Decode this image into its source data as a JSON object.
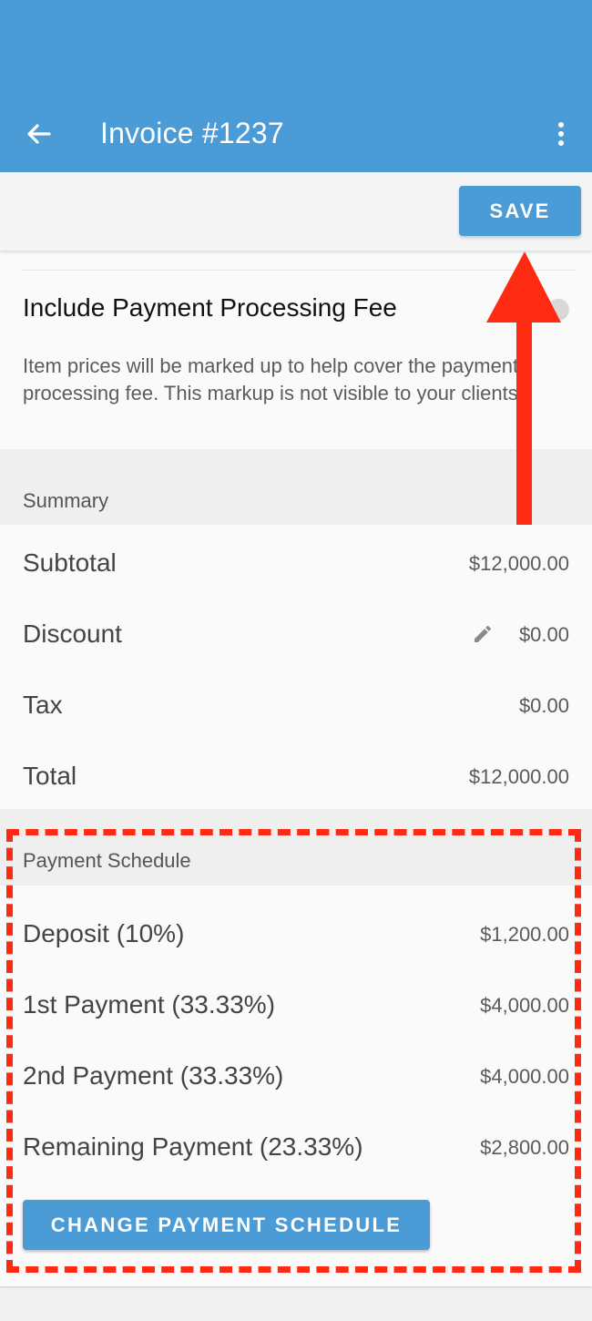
{
  "app_bar": {
    "title": "Invoice #1237",
    "back_icon": "arrow-left-icon",
    "menu_icon": "more-vert-icon",
    "color": "#4a9bd6"
  },
  "toolbar": {
    "save_label": "SAVE"
  },
  "payment_fee": {
    "title": "Include Payment Processing Fee",
    "description": "Item prices will be marked up to help cover the payment processing fee. This markup is not visible to your clients.",
    "enabled": false
  },
  "summary": {
    "header": "Summary",
    "rows": [
      {
        "label": "Subtotal",
        "value": "$12,000.00"
      },
      {
        "label": "Discount",
        "value": "$0.00",
        "icon": "pencil-icon"
      },
      {
        "label": "Tax",
        "value": "$0.00"
      },
      {
        "label": "Total",
        "value": "$12,000.00"
      }
    ]
  },
  "payment_schedule": {
    "header": "Payment Schedule",
    "rows": [
      {
        "label": "Deposit (10%)",
        "value": "$1,200.00"
      },
      {
        "label": "1st Payment (33.33%)",
        "value": "$4,000.00"
      },
      {
        "label": "2nd Payment (33.33%)",
        "value": "$4,000.00"
      },
      {
        "label": "Remaining Payment (23.33%)",
        "value": "$2,800.00"
      }
    ],
    "button_label": "CHANGE PAYMENT SCHEDULE"
  },
  "annotations": {
    "color": "#ff2a12",
    "arrow_icon": "arrow-up-icon"
  }
}
